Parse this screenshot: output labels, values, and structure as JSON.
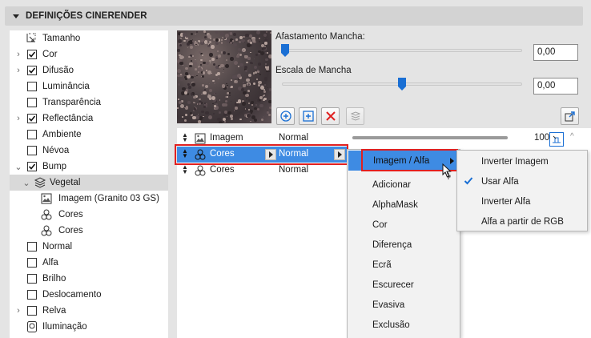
{
  "header": {
    "title": "DEFINIÇÕES CINERENDER"
  },
  "tree": {
    "items": [
      {
        "label": "Tamanho",
        "icon": "size-icon",
        "checkbox": null,
        "chevron": false,
        "indent": 0
      },
      {
        "label": "Cor",
        "checkbox": true,
        "chevron": true,
        "indent": 0
      },
      {
        "label": "Difusão",
        "checkbox": true,
        "chevron": true,
        "indent": 0
      },
      {
        "label": "Luminância",
        "checkbox": false,
        "chevron": false,
        "indent": 0
      },
      {
        "label": "Transparência",
        "checkbox": false,
        "chevron": false,
        "indent": 0
      },
      {
        "label": "Reflectância",
        "checkbox": true,
        "chevron": true,
        "indent": 0
      },
      {
        "label": "Ambiente",
        "checkbox": false,
        "chevron": false,
        "indent": 0
      },
      {
        "label": "Névoa",
        "checkbox": false,
        "chevron": false,
        "indent": 0
      },
      {
        "label": "Bump",
        "checkbox": true,
        "chevron": "down",
        "indent": 0
      },
      {
        "label": "Vegetal",
        "icon": "layers-icon",
        "checkbox": null,
        "chevron": "down",
        "indent": 1,
        "selected": true
      },
      {
        "label": "Imagem (Granito 03 GS)",
        "icon": "image-icon",
        "checkbox": null,
        "chevron": false,
        "indent": 2
      },
      {
        "label": "Cores",
        "icon": "colors-icon",
        "checkbox": null,
        "chevron": false,
        "indent": 2
      },
      {
        "label": "Cores",
        "icon": "colors-icon",
        "checkbox": null,
        "chevron": false,
        "indent": 2
      },
      {
        "label": "Normal",
        "checkbox": false,
        "chevron": false,
        "indent": 0
      },
      {
        "label": "Alfa",
        "checkbox": false,
        "chevron": false,
        "indent": 0
      },
      {
        "label": "Brilho",
        "checkbox": false,
        "chevron": false,
        "indent": 0
      },
      {
        "label": "Deslocamento",
        "checkbox": false,
        "chevron": false,
        "indent": 0
      },
      {
        "label": "Relva",
        "checkbox": false,
        "chevron": true,
        "indent": 0
      },
      {
        "label": "Iluminação",
        "icon": "light-icon",
        "checkbox": null,
        "chevron": false,
        "indent": 0
      }
    ]
  },
  "params": {
    "spot_distance_label": "Afastamento Mancha:",
    "spot_distance_value": "0,00",
    "spot_distance_level": 0.0,
    "spot_scale_label": "Escala de Mancha",
    "spot_scale_value": "0,00",
    "spot_scale_level": 0.5
  },
  "layers": {
    "rows": [
      {
        "name": "Imagem",
        "icon": "image-icon",
        "blend": "Normal",
        "opacity": "100",
        "opacity_level": 1.0
      },
      {
        "name": "Cores",
        "icon": "colors-icon",
        "blend": "Normal",
        "selected": true
      },
      {
        "name": "Cores",
        "icon": "colors-icon",
        "blend": "Normal"
      }
    ]
  },
  "blend_menu": {
    "items": [
      "Imagem / Alfa",
      "Adicionar",
      "AlphaMask",
      "Cor",
      "Diferença",
      "Ecrã",
      "Escurecer",
      "Evasiva",
      "Exclusão"
    ],
    "highlighted": "Imagem / Alfa"
  },
  "submenu": {
    "items": [
      {
        "label": "Inverter Imagem",
        "checked": false
      },
      {
        "label": "Usar Alfa",
        "checked": true
      },
      {
        "label": "Inverter Alfa",
        "checked": false
      },
      {
        "label": "Alfa a partir de RGB",
        "checked": false
      }
    ]
  },
  "colors": {
    "selection": "#3e8be3",
    "highlight_red": "#e02020",
    "accent_blue": "#1a6fd4"
  }
}
